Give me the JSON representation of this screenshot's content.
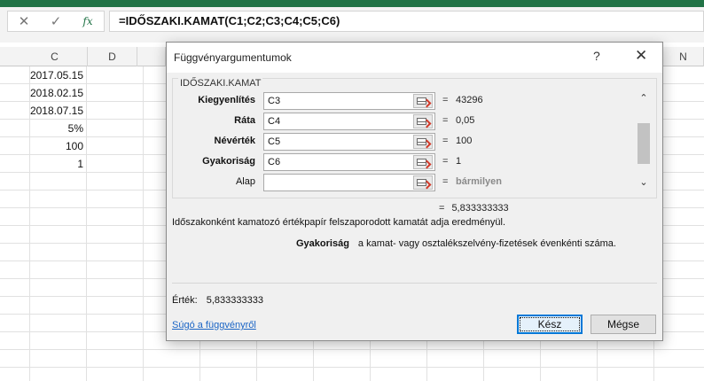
{
  "formula_bar": {
    "cancel_glyph": "✕",
    "enter_glyph": "✓",
    "fx_glyph": "fx",
    "formula": "=IDŐSZAKI.KAMAT(C1;C2;C3;C4;C5;C6)"
  },
  "columns": [
    "C",
    "D",
    "N"
  ],
  "cells": [
    "2017.05.15",
    "2018.02.15",
    "2018.07.15",
    "5%",
    "100",
    "1"
  ],
  "dialog": {
    "title": "Függvényargumentumok",
    "help_glyph": "?",
    "close_glyph": "✕",
    "function_name": "IDŐSZAKI.KAMAT",
    "args": [
      {
        "label": "Kiegyenlítés",
        "input": "C3",
        "eq": "=",
        "value": "43296"
      },
      {
        "label": "Ráta",
        "input": "C4",
        "eq": "=",
        "value": "0,05"
      },
      {
        "label": "Névérték",
        "input": "C5",
        "eq": "=",
        "value": "100"
      },
      {
        "label": "Gyakoriság",
        "input": "C6",
        "eq": "=",
        "value": "1"
      },
      {
        "label": "Alap",
        "input": "",
        "eq": "=",
        "value": "bármilyen"
      }
    ],
    "result_eq": "=",
    "result_value": "5,833333333",
    "description": "Időszakonként kamatozó értékpapír felszaporodott kamatát adja eredményül.",
    "arg_name": "Gyakoriság",
    "arg_description": "a kamat- vagy osztalékszelvény-fizetések évenkénti száma.",
    "value_label": "Érték:",
    "value": "5,833333333",
    "help_link": "Súgó a függvényről",
    "ok_label": "Kész",
    "cancel_label": "Mégse"
  }
}
